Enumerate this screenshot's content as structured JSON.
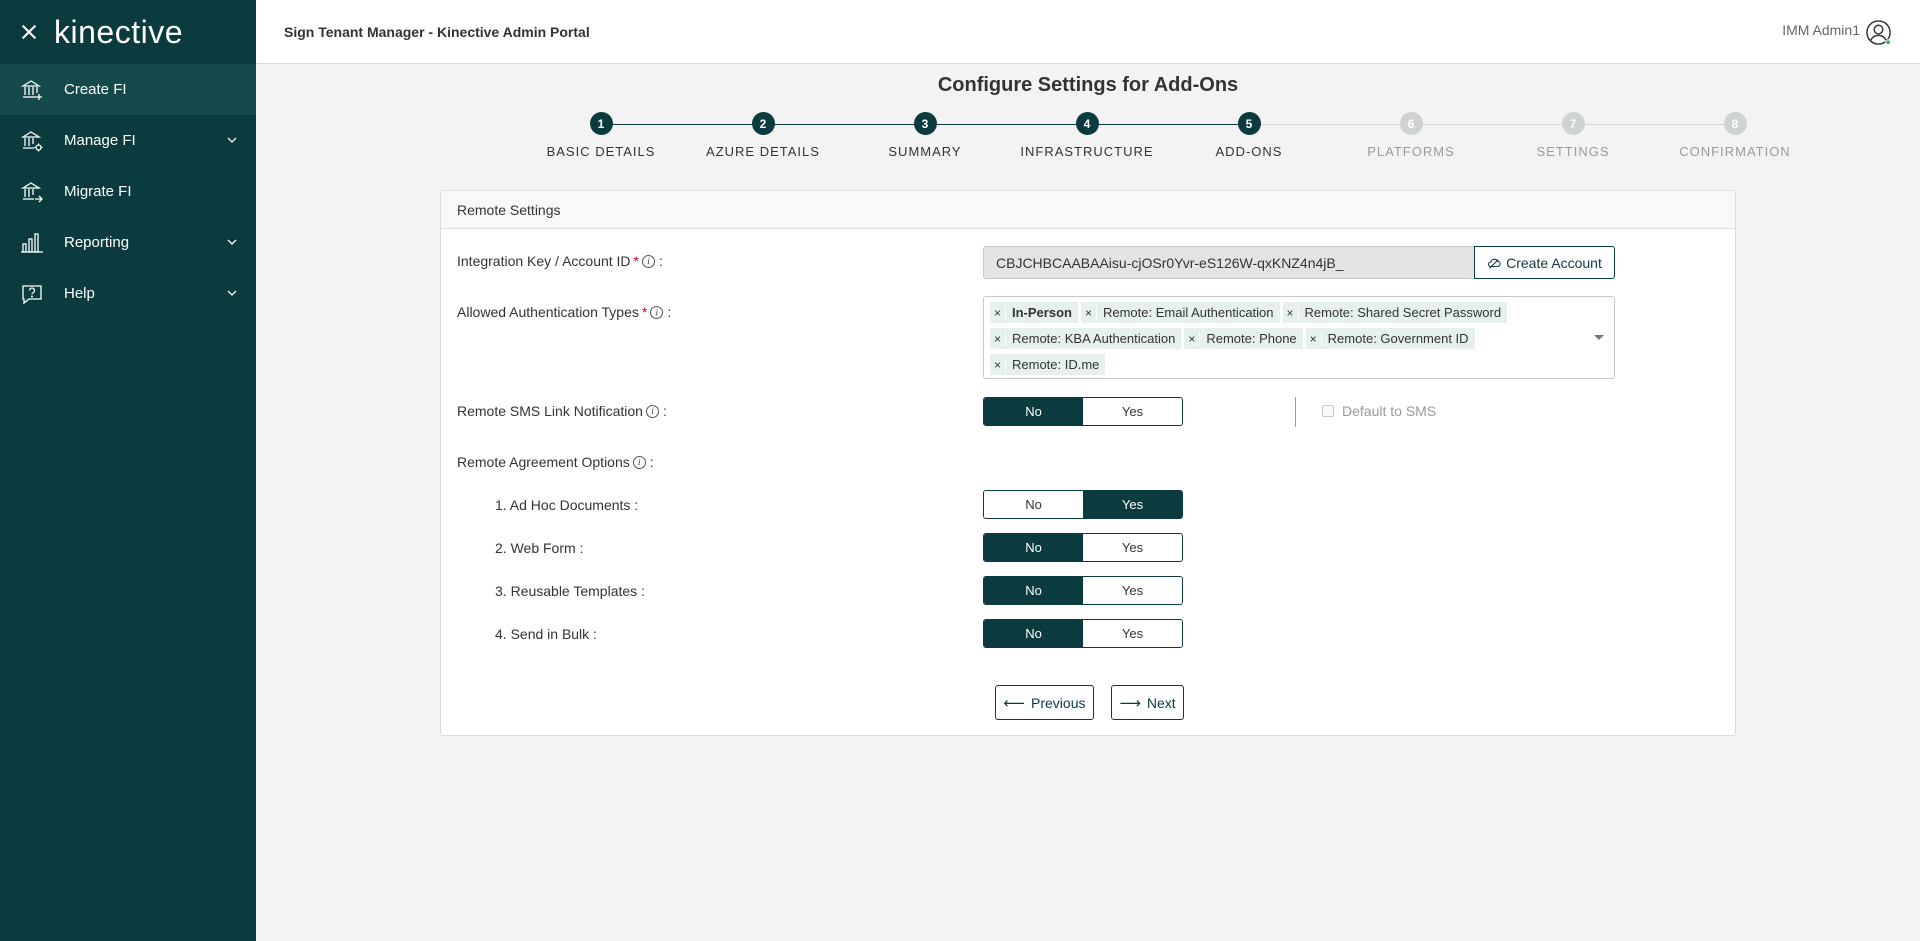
{
  "app": {
    "logo": "kinective",
    "header_title": "Sign Tenant Manager - Kinective Admin Portal",
    "user_name": "IMM Admin1"
  },
  "sidebar": {
    "items": [
      {
        "label": "Create FI",
        "icon": "bank-plus-icon",
        "active": true
      },
      {
        "label": "Manage FI",
        "icon": "bank-gear-icon",
        "expandable": true
      },
      {
        "label": "Migrate FI",
        "icon": "bank-arrow-icon"
      },
      {
        "label": "Reporting",
        "icon": "bar-chart-icon",
        "expandable": true
      },
      {
        "label": "Help",
        "icon": "help-icon",
        "expandable": true
      }
    ]
  },
  "page": {
    "title": "Configure Settings for Add-Ons"
  },
  "stepper": {
    "steps": [
      {
        "num": "1",
        "label": "BASIC DETAILS",
        "state": "done"
      },
      {
        "num": "2",
        "label": "AZURE DETAILS",
        "state": "done"
      },
      {
        "num": "3",
        "label": "SUMMARY",
        "state": "done"
      },
      {
        "num": "4",
        "label": "INFRASTRUCTURE",
        "state": "done"
      },
      {
        "num": "5",
        "label": "ADD-ONS",
        "state": "current"
      },
      {
        "num": "6",
        "label": "PLATFORMS",
        "state": "inactive"
      },
      {
        "num": "7",
        "label": "SETTINGS",
        "state": "inactive"
      },
      {
        "num": "8",
        "label": "CONFIRMATION",
        "state": "inactive"
      }
    ]
  },
  "form": {
    "card_title": "Remote Settings",
    "integration_key_label": "Integration Key / Account ID",
    "integration_key_value": "CBJCHBCAABAAisu-cjOSr0Yvr-eS126W-qxKNZ4n4jB_",
    "create_account_label": "Create Account",
    "auth_types_label": "Allowed Authentication Types",
    "auth_types": [
      {
        "label": "In-Person",
        "bold": true
      },
      {
        "label": "Remote: Email Authentication"
      },
      {
        "label": "Remote: Shared Secret Password"
      },
      {
        "label": "Remote: KBA Authentication"
      },
      {
        "label": "Remote: Phone"
      },
      {
        "label": "Remote: Government ID"
      },
      {
        "label": "Remote: ID.me"
      }
    ],
    "sms_label": "Remote SMS Link Notification",
    "sms_value": "No",
    "default_sms_label": "Default to SMS",
    "default_sms_checked": false,
    "agreement_label": "Remote Agreement Options",
    "options": [
      {
        "label": "1. Ad Hoc Documents :",
        "value": "Yes"
      },
      {
        "label": "2. Web Form :",
        "value": "No"
      },
      {
        "label": "3. Reusable Templates :",
        "value": "No"
      },
      {
        "label": "4. Send in Bulk :",
        "value": "No"
      }
    ],
    "no_label": "No",
    "yes_label": "Yes",
    "colon": ":",
    "required_mark": "*",
    "info_mark": "i"
  },
  "nav": {
    "previous_label": "Previous",
    "next_label": "Next"
  },
  "colors": {
    "primary": "#0b3b3e",
    "tag_bg": "#e6f0ef",
    "required": "#d0021b"
  }
}
